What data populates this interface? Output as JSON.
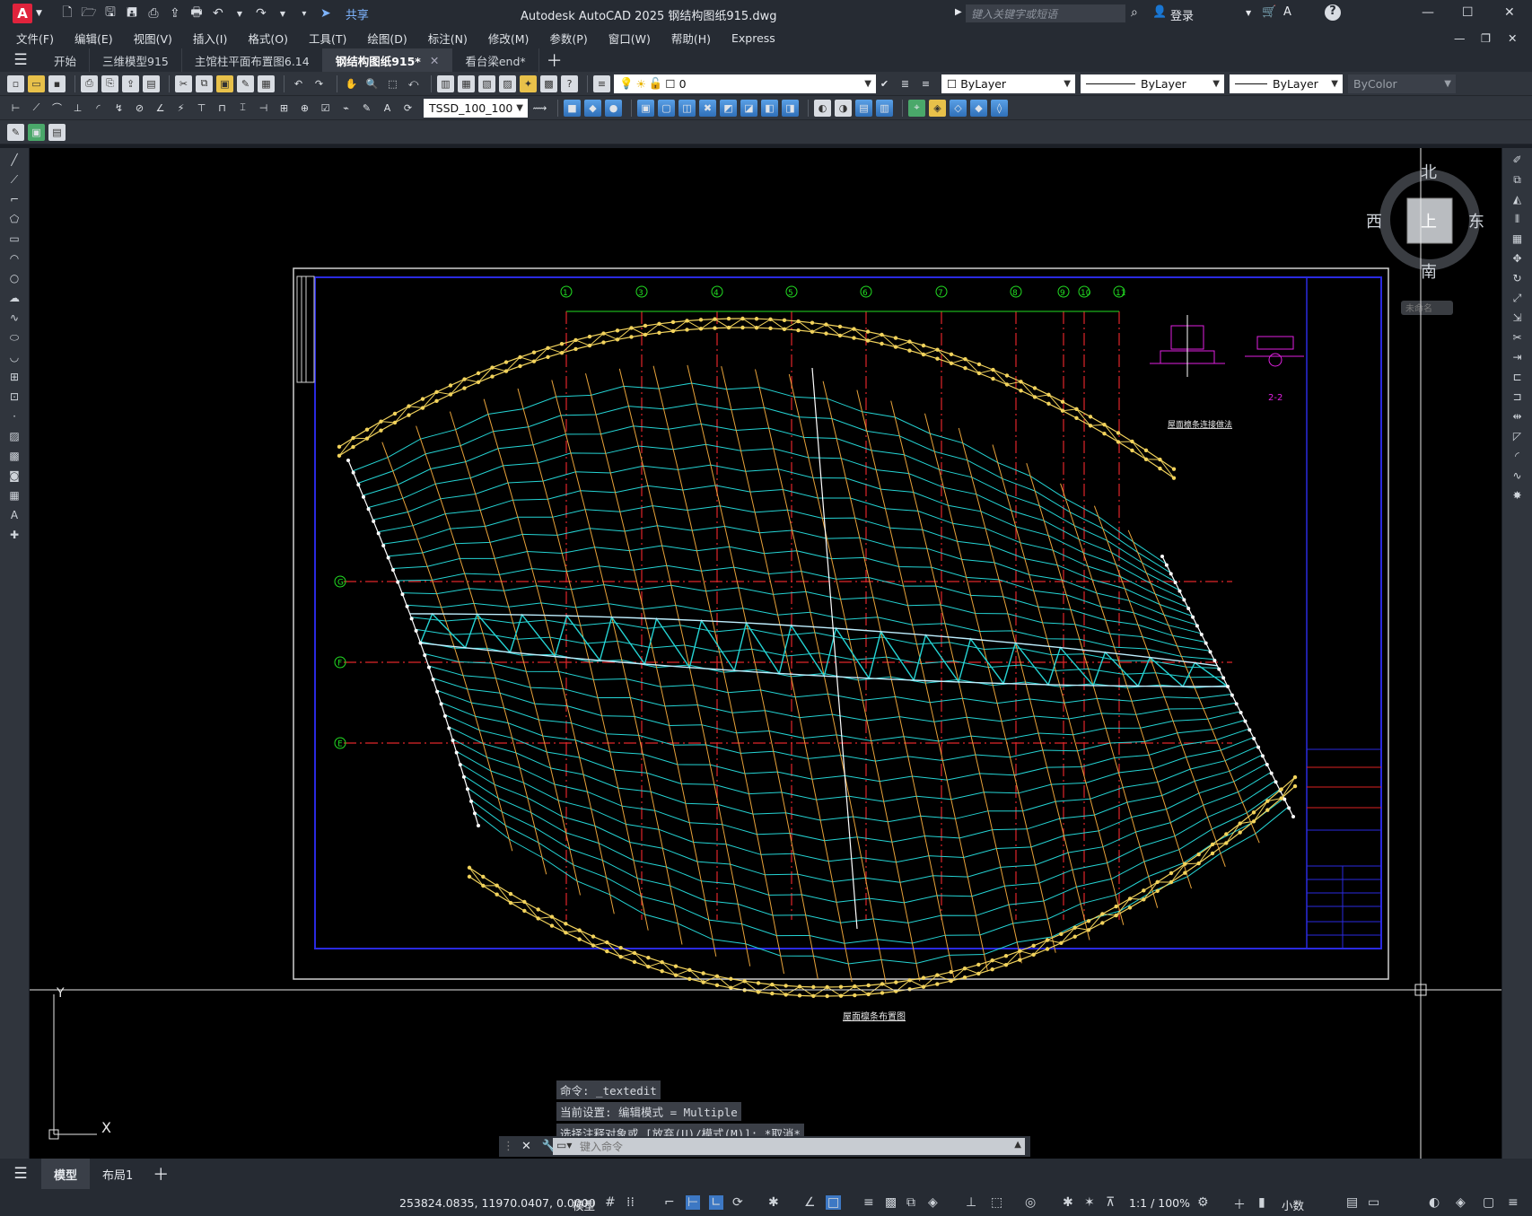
{
  "app": {
    "title": "Autodesk AutoCAD 2025    钢结构图纸915.dwg",
    "logo": "A",
    "share": "共享",
    "search_placeholder": "键入关键字或短语",
    "login": "登录"
  },
  "menu": [
    "文件(F)",
    "编辑(E)",
    "视图(V)",
    "插入(I)",
    "格式(O)",
    "工具(T)",
    "绘图(D)",
    "标注(N)",
    "修改(M)",
    "参数(P)",
    "窗口(W)",
    "帮助(H)",
    "Express"
  ],
  "tabs": [
    {
      "label": "开始",
      "active": false,
      "closable": false
    },
    {
      "label": "三维模型915",
      "active": false,
      "closable": false
    },
    {
      "label": "主馆柱平面布置图6.14",
      "active": false,
      "closable": false
    },
    {
      "label": "钢结构图纸915*",
      "active": true,
      "closable": true
    },
    {
      "label": "看台梁end*",
      "active": false,
      "closable": false
    }
  ],
  "toolbar": {
    "layer_value": "0",
    "color_value": "ByLayer",
    "linetype_value": "ByLayer",
    "lineweight_value": "ByLayer",
    "plotstyle_value": "ByColor",
    "dimstyle_value": "TSSD_100_100"
  },
  "viewcube": {
    "north": "北",
    "south": "南",
    "east": "东",
    "west": "西",
    "top": "上",
    "wcs": "未命名"
  },
  "drawing": {
    "grid_numbers": [
      "①",
      "③",
      "④",
      "⑤",
      "⑥",
      "⑦",
      "⑧",
      "⑨",
      "⑩",
      "⑪"
    ],
    "grid_letters": [
      "G",
      "F",
      "E"
    ],
    "plan_title": "屋面檩条布置图",
    "detail_title": "屋面檩条连接做法",
    "section_label": "2-2",
    "ucs_x": "X",
    "ucs_y": "Y"
  },
  "command": {
    "history": [
      "命令: _textedit",
      "当前设置: 编辑模式 = Multiple",
      "选择注释对象或 [放弃(U)/模式(M)]: *取消*"
    ],
    "placeholder": "键入命令"
  },
  "layouts": [
    "模型",
    "布局1"
  ],
  "status": {
    "coords": "253824.0835, 11970.0407, 0.0000",
    "space": "模型",
    "scale": "1:1 / 100%",
    "units": "小数"
  },
  "colors": {
    "purlin": "#25d4d4",
    "rafter": "#e8a33a",
    "grid_red": "#e0262a",
    "border_blue": "#1a1ad8",
    "node_yellow": "#f2d35c",
    "green_label": "#22dd22"
  }
}
